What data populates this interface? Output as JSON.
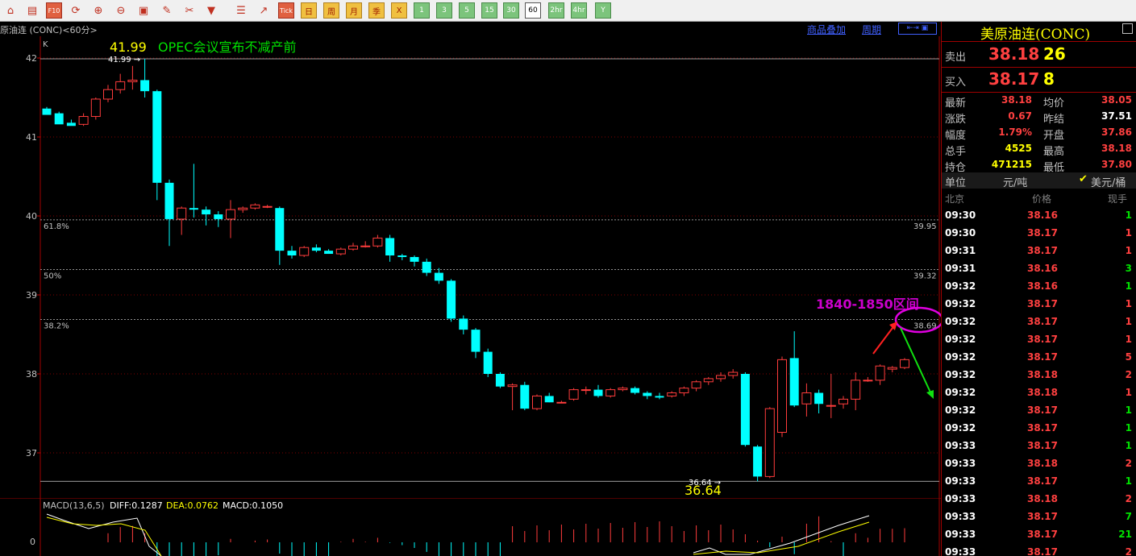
{
  "toolbar": {
    "buttons": [
      {
        "name": "home-button",
        "type": "ico",
        "text": "⌂"
      },
      {
        "name": "notebook-button",
        "type": "ico",
        "text": "▤"
      },
      {
        "name": "f10-button",
        "type": "rbtn",
        "text": "F10"
      },
      {
        "name": "refresh-button",
        "type": "ico",
        "text": "⟳"
      },
      {
        "name": "zoom-in-button",
        "type": "ico",
        "text": "⊕"
      },
      {
        "name": "zoom-out-button",
        "type": "ico",
        "text": "⊖"
      },
      {
        "name": "window-button",
        "type": "ico",
        "text": "▣"
      },
      {
        "name": "pen-button",
        "type": "ico",
        "text": "✎"
      },
      {
        "name": "tools-button",
        "type": "ico",
        "text": "✂"
      },
      {
        "name": "filter-button",
        "type": "ico",
        "text": "▼"
      },
      {
        "name": "list-button",
        "type": "ico",
        "text": "☰"
      },
      {
        "name": "trend-button",
        "type": "ico",
        "text": "↗"
      },
      {
        "name": "tick-button",
        "type": "rbtn",
        "text": "Tick"
      },
      {
        "name": "day-button",
        "type": "ybtn",
        "text": "日"
      },
      {
        "name": "week-button",
        "type": "ybtn",
        "text": "周"
      },
      {
        "name": "month-button",
        "type": "ybtn",
        "text": "月"
      },
      {
        "name": "quarter-button",
        "type": "ybtn",
        "text": "季"
      },
      {
        "name": "year-button",
        "type": "ybtn",
        "text": "X"
      },
      {
        "name": "1min-button",
        "type": "gbtn",
        "text": "1"
      },
      {
        "name": "3min-button",
        "type": "gbtn",
        "text": "3"
      },
      {
        "name": "5min-button",
        "type": "gbtn",
        "text": "5"
      },
      {
        "name": "15min-button",
        "type": "gbtn",
        "text": "15"
      },
      {
        "name": "30min-button",
        "type": "gbtn",
        "text": "30"
      },
      {
        "name": "60min-button",
        "type": "sel",
        "text": "60"
      },
      {
        "name": "2hr-button",
        "type": "gbtn",
        "text": "2hr"
      },
      {
        "name": "4hr-button",
        "type": "gbtn",
        "text": "4hr"
      },
      {
        "name": "y-button",
        "type": "gbtn",
        "text": "Y"
      }
    ]
  },
  "header": {
    "title": "原油连 (CONC)<60分>",
    "overlay_link": "商品叠加",
    "cycle_link": "周期",
    "k_label": "K"
  },
  "annotations": {
    "high_label": "41.99",
    "high_small": "41.99",
    "opec_note": "OPEC会议宣布不减产前",
    "low_label": "36.64",
    "low_small": "36.64",
    "zone_note": "1840-1850区间",
    "colors": {
      "yellow": "#ffff00",
      "green": "#00e000",
      "magenta": "#cc00cc"
    }
  },
  "fib_levels": [
    {
      "label": "61.8%",
      "value": "39.95",
      "price": 39.95
    },
    {
      "label": "50%",
      "value": "39.32",
      "price": 39.32
    },
    {
      "label": "38.2%",
      "value": "38.69",
      "price": 38.69
    }
  ],
  "chart_data": {
    "type": "candlestick",
    "ylim": [
      36.6,
      42.1
    ],
    "yticks": [
      "42",
      "41",
      "40",
      "39",
      "38",
      "37"
    ],
    "candles": [
      [
        41.36,
        41.38,
        41.3,
        41.28
      ],
      [
        41.3,
        41.32,
        41.18,
        41.16
      ],
      [
        41.18,
        41.22,
        41.16,
        41.14
      ],
      [
        41.16,
        41.3,
        41.14,
        41.26
      ],
      [
        41.26,
        41.5,
        41.22,
        41.48
      ],
      [
        41.48,
        41.66,
        41.44,
        41.6
      ],
      [
        41.6,
        41.8,
        41.55,
        41.7
      ],
      [
        41.7,
        41.9,
        41.6,
        41.72
      ],
      [
        41.72,
        41.99,
        41.5,
        41.58
      ],
      [
        41.58,
        41.6,
        40.2,
        40.42
      ],
      [
        40.42,
        40.46,
        39.62,
        39.96
      ],
      [
        39.96,
        40.12,
        39.76,
        40.1
      ],
      [
        40.1,
        40.66,
        39.98,
        40.08
      ],
      [
        40.08,
        40.12,
        39.88,
        40.02
      ],
      [
        40.02,
        40.06,
        39.86,
        39.96
      ],
      [
        39.96,
        40.2,
        39.72,
        40.08
      ],
      [
        40.08,
        40.12,
        40.04,
        40.1
      ],
      [
        40.1,
        40.16,
        40.08,
        40.14
      ],
      [
        40.12,
        40.14,
        40.1,
        40.12
      ],
      [
        40.1,
        40.12,
        39.38,
        39.56
      ],
      [
        39.56,
        39.62,
        39.46,
        39.5
      ],
      [
        39.5,
        39.62,
        39.48,
        39.6
      ],
      [
        39.6,
        39.64,
        39.54,
        39.56
      ],
      [
        39.56,
        39.58,
        39.52,
        39.52
      ],
      [
        39.52,
        39.6,
        39.5,
        39.58
      ],
      [
        39.58,
        39.66,
        39.56,
        39.62
      ],
      [
        39.62,
        39.68,
        39.6,
        39.62
      ],
      [
        39.62,
        39.76,
        39.6,
        39.72
      ],
      [
        39.72,
        39.76,
        39.42,
        39.5
      ],
      [
        39.5,
        39.52,
        39.44,
        39.48
      ],
      [
        39.48,
        39.5,
        39.36,
        39.42
      ],
      [
        39.42,
        39.46,
        39.24,
        39.28
      ],
      [
        39.28,
        39.34,
        39.14,
        39.18
      ],
      [
        39.18,
        39.2,
        38.66,
        38.7
      ],
      [
        38.7,
        38.74,
        38.5,
        38.56
      ],
      [
        38.56,
        38.58,
        38.2,
        38.28
      ],
      [
        38.28,
        38.32,
        37.96,
        38.0
      ],
      [
        38.0,
        38.02,
        37.82,
        37.84
      ],
      [
        37.84,
        37.88,
        37.54,
        37.86
      ],
      [
        37.86,
        37.9,
        37.54,
        37.56
      ],
      [
        37.56,
        37.74,
        37.54,
        37.72
      ],
      [
        37.72,
        37.76,
        37.64,
        37.64
      ],
      [
        37.64,
        37.66,
        37.64,
        37.64
      ],
      [
        37.68,
        37.82,
        37.66,
        37.8
      ],
      [
        37.8,
        37.84,
        37.74,
        37.8
      ],
      [
        37.8,
        37.86,
        37.7,
        37.72
      ],
      [
        37.72,
        37.82,
        37.7,
        37.8
      ],
      [
        37.8,
        37.84,
        37.78,
        37.82
      ],
      [
        37.82,
        37.84,
        37.74,
        37.76
      ],
      [
        37.76,
        37.78,
        37.68,
        37.72
      ],
      [
        37.72,
        37.76,
        37.68,
        37.7
      ],
      [
        37.72,
        37.78,
        37.7,
        37.76
      ],
      [
        37.76,
        37.84,
        37.72,
        37.82
      ],
      [
        37.82,
        37.92,
        37.78,
        37.9
      ],
      [
        37.9,
        37.96,
        37.86,
        37.94
      ],
      [
        37.94,
        38.02,
        37.9,
        37.98
      ],
      [
        37.98,
        38.06,
        37.94,
        38.02
      ],
      [
        38.0,
        38.02,
        37.08,
        37.1
      ],
      [
        37.08,
        37.1,
        36.64,
        36.7
      ],
      [
        36.7,
        37.58,
        36.68,
        37.56
      ],
      [
        37.26,
        38.22,
        37.2,
        38.18
      ],
      [
        38.2,
        38.54,
        37.58,
        37.6
      ],
      [
        37.62,
        37.88,
        37.46,
        37.76
      ],
      [
        37.76,
        37.8,
        37.5,
        37.62
      ],
      [
        37.6,
        38.0,
        37.44,
        37.6
      ],
      [
        37.62,
        37.72,
        37.56,
        37.68
      ],
      [
        37.68,
        38.02,
        37.54,
        37.92
      ],
      [
        37.92,
        37.96,
        37.9,
        37.92
      ],
      [
        37.92,
        38.12,
        37.86,
        38.1
      ],
      [
        38.06,
        38.1,
        38.02,
        38.08
      ],
      [
        38.08,
        38.2,
        38.06,
        38.18
      ]
    ],
    "macd": {
      "label": "MACD(13,6,5)",
      "diff": "DIFF:0.1287",
      "dea": "DEA:0.0762",
      "macd": "MACD:0.1050",
      "zero_label": "0"
    }
  },
  "panel": {
    "title": "美原油连(CONC)",
    "sell_label": "卖出",
    "sell_price": "38.18",
    "sell_qty": "26",
    "buy_label": "买入",
    "buy_price": "38.17",
    "buy_qty": "8",
    "stats": [
      {
        "l1": "最新",
        "v1": "38.18",
        "c1": "red",
        "l2": "均价",
        "v2": "38.05",
        "c2": "red"
      },
      {
        "l1": "涨跌",
        "v1": "0.67",
        "c1": "red",
        "l2": "昨结",
        "v2": "37.51",
        "c2": "white"
      },
      {
        "l1": "幅度",
        "v1": "1.79%",
        "c1": "red",
        "l2": "开盘",
        "v2": "37.86",
        "c2": "red"
      },
      {
        "l1": "总手",
        "v1": "4525",
        "c1": "yel",
        "l2": "最高",
        "v2": "38.18",
        "c2": "red"
      },
      {
        "l1": "持仓",
        "v1": "471215",
        "c1": "yel",
        "l2": "最低",
        "v2": "37.80",
        "c2": "red"
      }
    ],
    "unit_label": "单位",
    "unit_a": "元/吨",
    "unit_b": "美元/桶",
    "tick_header": {
      "time": "北京",
      "price": "价格",
      "qty": "现手"
    },
    "ticks": [
      [
        "09:30",
        "38.16",
        "1",
        "grn"
      ],
      [
        "09:30",
        "38.17",
        "1",
        "red"
      ],
      [
        "09:31",
        "38.17",
        "1",
        "red"
      ],
      [
        "09:31",
        "38.16",
        "3",
        "grn"
      ],
      [
        "09:32",
        "38.16",
        "1",
        "grn"
      ],
      [
        "09:32",
        "38.17",
        "1",
        "red"
      ],
      [
        "09:32",
        "38.17",
        "1",
        "red"
      ],
      [
        "09:32",
        "38.17",
        "1",
        "red"
      ],
      [
        "09:32",
        "38.17",
        "5",
        "red"
      ],
      [
        "09:32",
        "38.18",
        "2",
        "red"
      ],
      [
        "09:32",
        "38.18",
        "1",
        "red"
      ],
      [
        "09:32",
        "38.17",
        "1",
        "grn"
      ],
      [
        "09:32",
        "38.17",
        "1",
        "grn"
      ],
      [
        "09:33",
        "38.17",
        "1",
        "grn"
      ],
      [
        "09:33",
        "38.18",
        "2",
        "red"
      ],
      [
        "09:33",
        "38.17",
        "1",
        "grn"
      ],
      [
        "09:33",
        "38.18",
        "2",
        "red"
      ],
      [
        "09:33",
        "38.17",
        "7",
        "grn"
      ],
      [
        "09:33",
        "38.17",
        "21",
        "grn"
      ],
      [
        "09:33",
        "38.17",
        "2",
        "red"
      ]
    ]
  }
}
